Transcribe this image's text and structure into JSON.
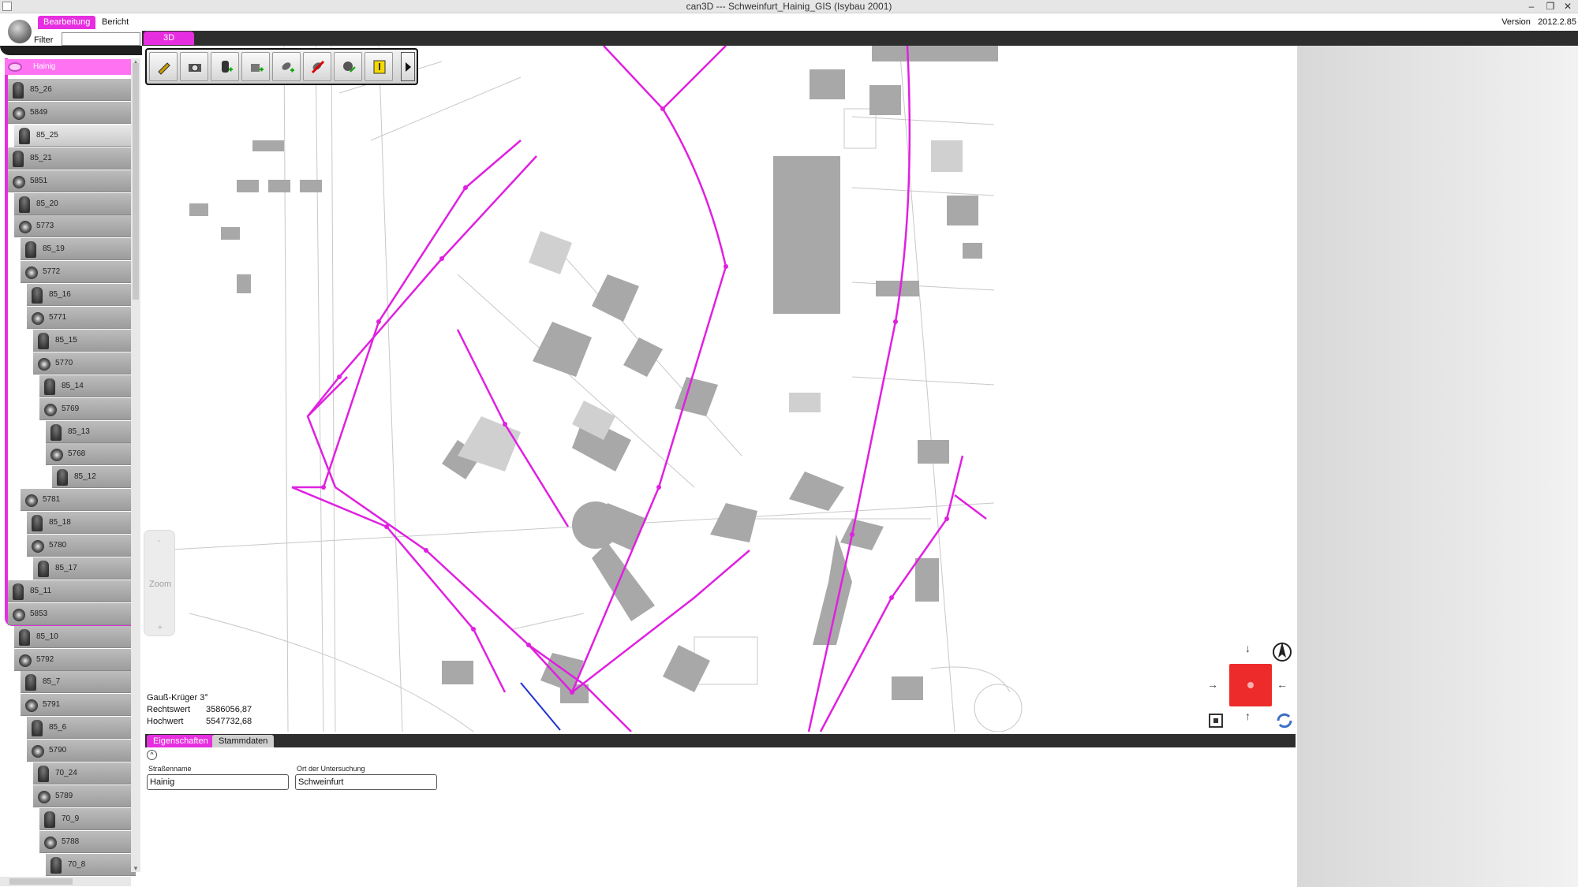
{
  "window": {
    "title": "can3D --- Schweinfurt_Hainig_GIS (Isybau 2001)",
    "controls": [
      "–",
      "❐",
      "✕"
    ]
  },
  "ribbon": {
    "tabs": [
      "Bearbeitung",
      "Bericht"
    ],
    "filter_label": "Filter",
    "filter_value": "",
    "version_label": "Version",
    "version_value": "2012.2.85"
  },
  "view_tab": "3D",
  "tree": {
    "root": "Hainig",
    "items": [
      {
        "label": "85_26",
        "type": "node",
        "indent": 0
      },
      {
        "label": "5849",
        "type": "pipe",
        "indent": 0
      },
      {
        "label": "85_25",
        "type": "node",
        "indent": 1,
        "selected": true
      },
      {
        "label": "85_21",
        "type": "node",
        "indent": 0
      },
      {
        "label": "5851",
        "type": "pipe",
        "indent": 0
      },
      {
        "label": "85_20",
        "type": "node",
        "indent": 1
      },
      {
        "label": "5773",
        "type": "pipe",
        "indent": 1
      },
      {
        "label": "85_19",
        "type": "node",
        "indent": 2
      },
      {
        "label": "5772",
        "type": "pipe",
        "indent": 2
      },
      {
        "label": "85_16",
        "type": "node",
        "indent": 3
      },
      {
        "label": "5771",
        "type": "pipe",
        "indent": 3
      },
      {
        "label": "85_15",
        "type": "node",
        "indent": 4
      },
      {
        "label": "5770",
        "type": "pipe",
        "indent": 4
      },
      {
        "label": "85_14",
        "type": "node",
        "indent": 5
      },
      {
        "label": "5769",
        "type": "pipe",
        "indent": 5
      },
      {
        "label": "85_13",
        "type": "node",
        "indent": 6
      },
      {
        "label": "5768",
        "type": "pipe",
        "indent": 6
      },
      {
        "label": "85_12",
        "type": "node",
        "indent": 7
      },
      {
        "label": "5781",
        "type": "pipe",
        "indent": 2
      },
      {
        "label": "85_18",
        "type": "node",
        "indent": 3
      },
      {
        "label": "5780",
        "type": "pipe",
        "indent": 3
      },
      {
        "label": "85_17",
        "type": "node",
        "indent": 4
      },
      {
        "label": "85_11",
        "type": "node",
        "indent": 0
      },
      {
        "label": "5853",
        "type": "pipe",
        "indent": 0
      },
      {
        "label": "85_10",
        "type": "node",
        "indent": 1
      },
      {
        "label": "5792",
        "type": "pipe",
        "indent": 1
      },
      {
        "label": "85_7",
        "type": "node",
        "indent": 2
      },
      {
        "label": "5791",
        "type": "pipe",
        "indent": 2
      },
      {
        "label": "85_6",
        "type": "node",
        "indent": 3
      },
      {
        "label": "5790",
        "type": "pipe",
        "indent": 3
      },
      {
        "label": "70_24",
        "type": "node",
        "indent": 4
      },
      {
        "label": "5789",
        "type": "pipe",
        "indent": 4
      },
      {
        "label": "70_9",
        "type": "node",
        "indent": 5
      },
      {
        "label": "5788",
        "type": "pipe",
        "indent": 5
      },
      {
        "label": "70_8",
        "type": "node",
        "indent": 6
      }
    ]
  },
  "toolbar": {
    "buttons": [
      {
        "icon": "edit-pencil-icon"
      },
      {
        "icon": "camera-icon"
      },
      {
        "icon": "add-manhole-icon"
      },
      {
        "icon": "add-object-icon"
      },
      {
        "icon": "add-pipe-icon"
      },
      {
        "icon": "delete-pipe-icon"
      },
      {
        "icon": "pipe-settings-icon"
      },
      {
        "icon": "info-icon"
      }
    ],
    "next": "next-arrow-icon"
  },
  "zoom": {
    "label": "Zoom",
    "minus": "-",
    "plus": "+"
  },
  "coordinates": {
    "system": "Gauß-Krüger 3°",
    "rechtswert_label": "Rechtswert",
    "rechtswert_value": "3586056,87",
    "hochwert_label": "Hochwert",
    "hochwert_value": "5547732,68"
  },
  "properties": {
    "tabs": [
      "Eigenschaften",
      "Stammdaten"
    ],
    "collapse_icon": "collapse-up-icon",
    "fields": [
      {
        "label": "Straßenname",
        "value": "Hainig"
      },
      {
        "label": "Ort der Untersuchung",
        "value": "Schweinfurt"
      }
    ]
  },
  "colors": {
    "accent": "#e62ee0",
    "pipe_network": "#e020e0",
    "nav_center": "#ee2b2b"
  }
}
